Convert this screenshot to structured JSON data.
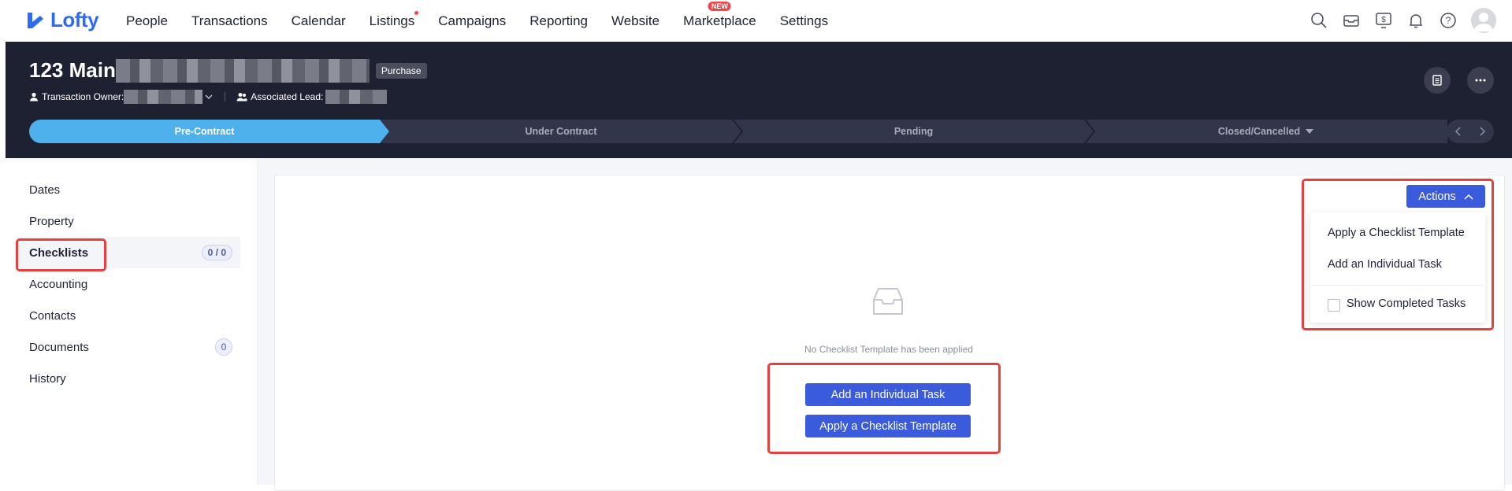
{
  "app": {
    "logo_text": "Lofty",
    "brand_color": "#2f6bf1"
  },
  "nav": {
    "items": [
      {
        "label": "People"
      },
      {
        "label": "Transactions"
      },
      {
        "label": "Calendar"
      },
      {
        "label": "Listings",
        "dot": true
      },
      {
        "label": "Campaigns"
      },
      {
        "label": "Reporting"
      },
      {
        "label": "Website"
      },
      {
        "label": "Marketplace",
        "badge": "NEW"
      },
      {
        "label": "Settings"
      }
    ],
    "icons": [
      "search-icon",
      "inbox-icon",
      "dollar-monitor-icon",
      "bell-icon",
      "help-icon",
      "user-avatar"
    ]
  },
  "transaction": {
    "title": "123 Main",
    "type_tag": "Purchase",
    "owner_label": "Transaction Owner:",
    "lead_label": "Associated Lead:",
    "header_bg": "#1e2131"
  },
  "stages": {
    "items": [
      {
        "label": "Pre-Contract",
        "active": true
      },
      {
        "label": "Under Contract"
      },
      {
        "label": "Pending"
      },
      {
        "label": "Closed/Cancelled",
        "has_dropdown": true
      }
    ],
    "active_color": "#4eb1ec"
  },
  "sidebar": {
    "items": [
      {
        "label": "Dates"
      },
      {
        "label": "Property"
      },
      {
        "label": "Checklists",
        "count": "0 / 0",
        "active": true
      },
      {
        "label": "Accounting"
      },
      {
        "label": "Contacts"
      },
      {
        "label": "Documents",
        "count": "0"
      },
      {
        "label": "History"
      }
    ]
  },
  "checklist": {
    "empty_text": "No Checklist Template has been applied",
    "add_task_button": "Add an Individual Task",
    "apply_template_button": "Apply a Checklist Template"
  },
  "actions": {
    "button_label": "Actions",
    "menu": {
      "apply_template": "Apply a Checklist Template",
      "add_task": "Add an Individual Task",
      "show_completed": "Show Completed Tasks",
      "show_completed_checked": false
    }
  },
  "highlight_color": "#e5413f"
}
